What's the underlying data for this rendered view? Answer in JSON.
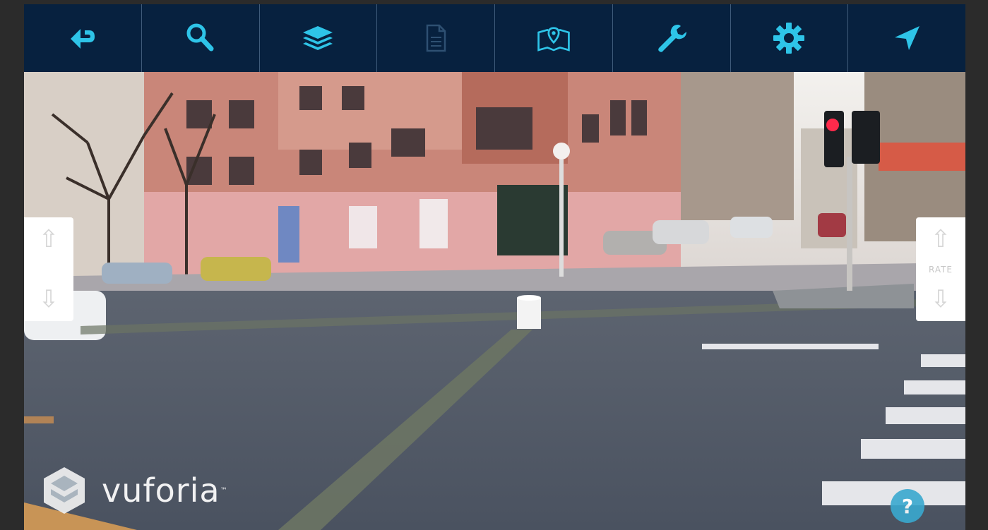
{
  "toolbar": {
    "buttons": [
      {
        "icon": "back-arrow-icon",
        "enabled": true
      },
      {
        "icon": "search-icon",
        "enabled": true
      },
      {
        "icon": "layers-icon",
        "enabled": true
      },
      {
        "icon": "document-icon",
        "enabled": false
      },
      {
        "icon": "map-pin-icon",
        "enabled": true
      },
      {
        "icon": "wrench-icon",
        "enabled": true
      },
      {
        "icon": "gear-icon",
        "enabled": true
      },
      {
        "icon": "navigation-arrow-icon",
        "enabled": true
      }
    ]
  },
  "left_panel": {
    "up": "⇧",
    "down": "⇩"
  },
  "right_panel": {
    "up": "⇧",
    "label": "RATE",
    "down": "⇩"
  },
  "logo": {
    "text": "vuforia",
    "tm": "™"
  },
  "help": {
    "label": "?"
  },
  "colors": {
    "toolbar_bg": "#07213f",
    "icon_accent": "#2ec4e8",
    "icon_disabled": "#2e5072",
    "help_bg": "#3aa9cf"
  }
}
